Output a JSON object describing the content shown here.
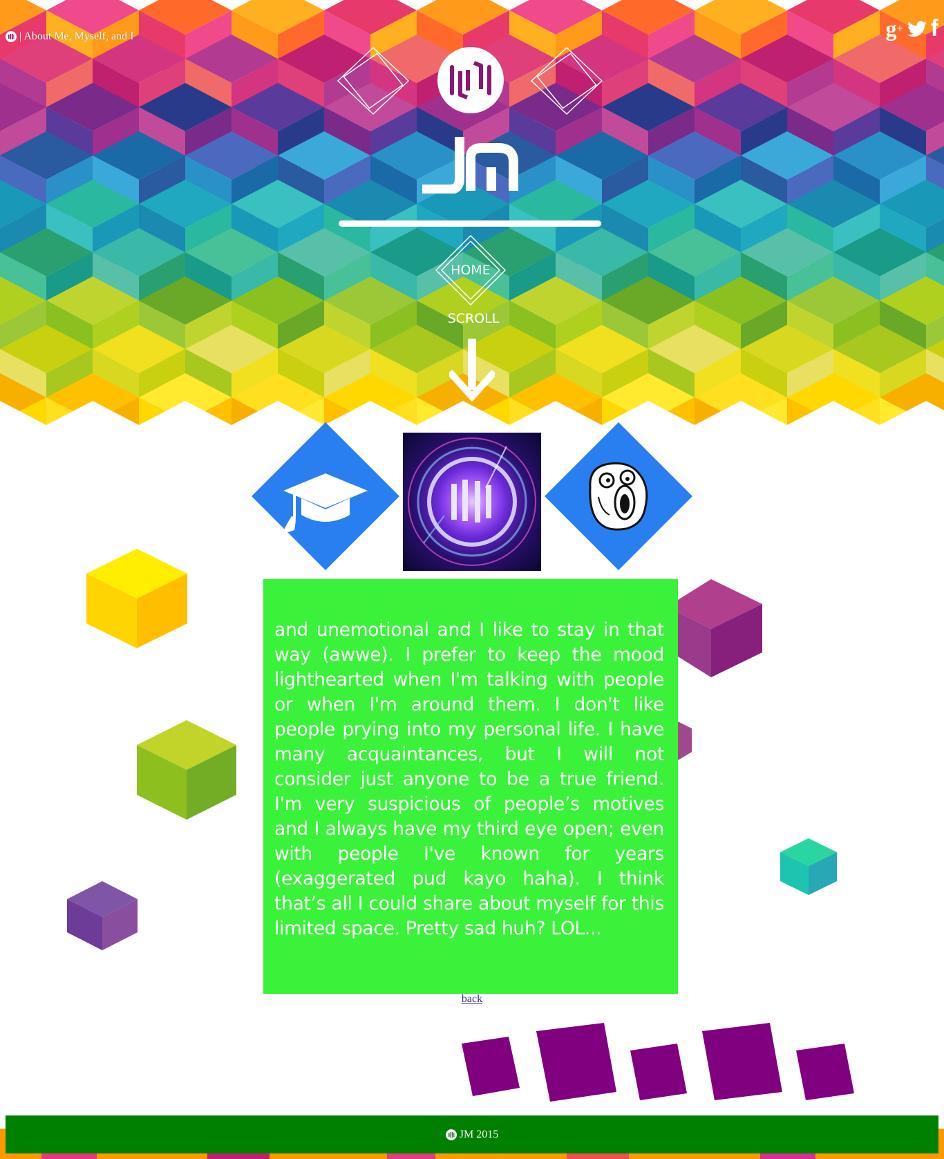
{
  "header": {
    "tab_title": "| About Me, Myself, and I",
    "social": [
      "google-plus",
      "twitter",
      "facebook"
    ]
  },
  "nav": {
    "home_label": "HOME",
    "scroll_label": "SCROLL"
  },
  "about": {
    "text": "and unemotional and I like to stay in that way (awwe). I prefer to keep the mood lighthearted when I'm talking with people or when I'm around them. I don't like people prying into my personal life. I have many acquaintances, but I will not consider just anyone to be a true friend. I'm very suspicious of people’s motives and I always have my third eye open; even with people I've known for years (exaggerated pud kayo haha). I think that’s all I could share about myself for this limited space. Pretty sad huh? LOL..."
  },
  "links": {
    "back_label": "back"
  },
  "footer": {
    "text": "JM 2015"
  },
  "colors": {
    "text_box": "#3bf23b",
    "footer": "#008000",
    "diamond_blue": "#2a7ff0",
    "purple_tiles": "#800080"
  }
}
